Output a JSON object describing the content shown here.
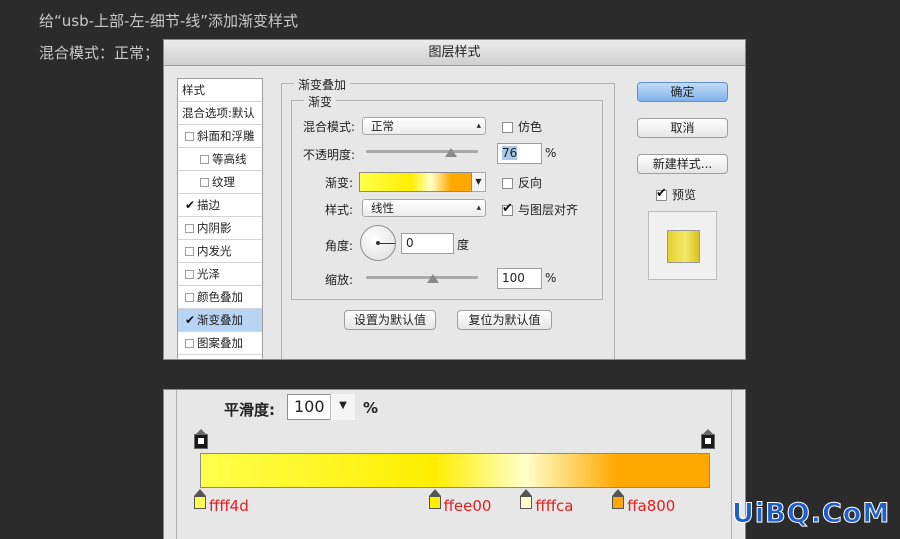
{
  "captions": {
    "line1": "给“usb-上部-左-细节-线”添加渐变样式",
    "line2": "混合模式：正常；"
  },
  "dialog": {
    "title": "图层样式",
    "styles_panel": {
      "header": "样式",
      "blend_options": "混合选项:默认",
      "items": [
        {
          "label": "斜面和浮雕",
          "checked": false
        },
        {
          "label": "等高线",
          "checked": false
        },
        {
          "label": "纹理",
          "checked": false
        },
        {
          "label": "描边",
          "checked": true
        },
        {
          "label": "内阴影",
          "checked": false
        },
        {
          "label": "内发光",
          "checked": false
        },
        {
          "label": "光泽",
          "checked": false
        },
        {
          "label": "颜色叠加",
          "checked": false
        },
        {
          "label": "渐变叠加",
          "checked": true,
          "selected": true
        },
        {
          "label": "图案叠加",
          "checked": false
        }
      ]
    },
    "section_title": "渐变叠加",
    "group_title": "渐变",
    "blend_mode": {
      "label": "混合模式:",
      "value": "正常"
    },
    "dither": {
      "label": "仿色",
      "checked": false
    },
    "opacity": {
      "label": "不透明度:",
      "value": "76",
      "unit": "%",
      "level": 0.76
    },
    "gradient": {
      "label": "渐变:"
    },
    "reverse": {
      "label": "反向",
      "checked": false
    },
    "style": {
      "label": "样式:",
      "value": "线性"
    },
    "align_with_layer": {
      "label": "与图层对齐",
      "checked": true
    },
    "angle": {
      "label": "角度:",
      "value": "0",
      "unit": "度"
    },
    "scale": {
      "label": "缩放:",
      "value": "100",
      "unit": "%",
      "level": 0.6
    },
    "buttons": {
      "make_default": "设置为默认值",
      "reset_default": "复位为默认值",
      "ok": "确定",
      "cancel": "取消",
      "new_style": "新建样式..."
    },
    "preview": {
      "label": "预览",
      "checked": true
    }
  },
  "gradient_editor": {
    "smoothness": {
      "label": "平滑度:",
      "value": "100",
      "unit": "%"
    },
    "stops": [
      {
        "label": "ffff4d",
        "color": "#ffff4d",
        "position": 0
      },
      {
        "label": "ffee00",
        "color": "#ffee00",
        "position": 0.46
      },
      {
        "label": "ffffca",
        "color": "#ffffca",
        "position": 0.64
      },
      {
        "label": "ffa800",
        "color": "#ffa800",
        "position": 0.82
      }
    ]
  },
  "watermark": "UiBQ.CoM"
}
